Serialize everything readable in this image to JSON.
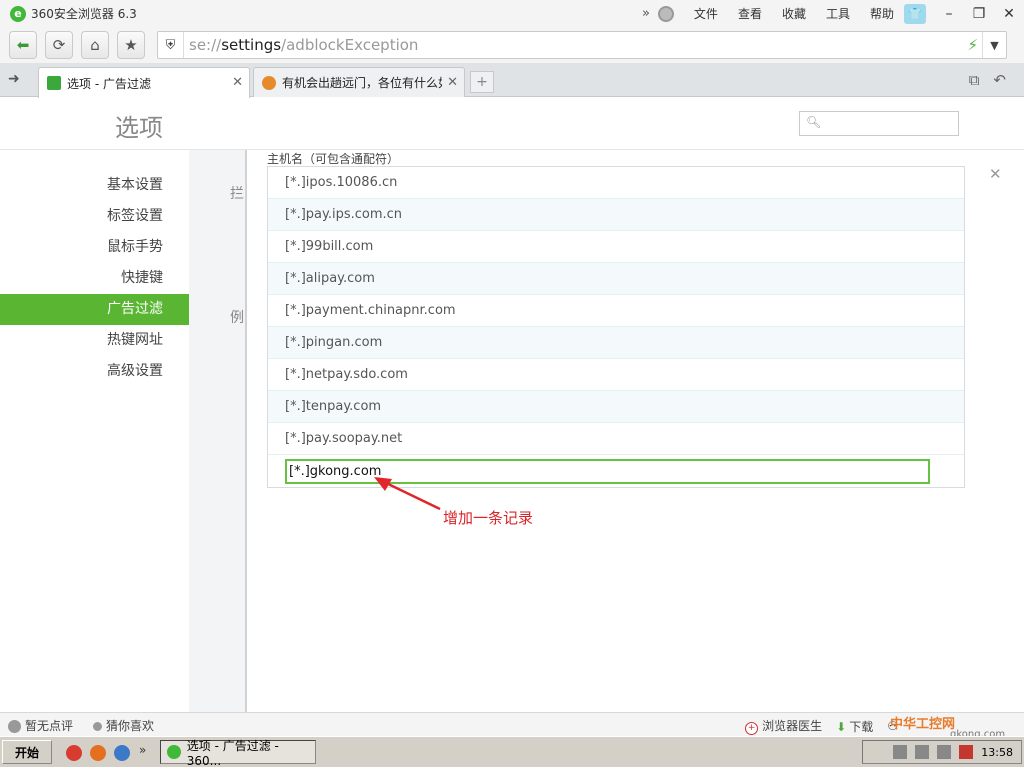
{
  "window": {
    "app_title": "360安全浏览器 6.3",
    "menus": [
      "文件",
      "查看",
      "收藏",
      "工具",
      "帮助"
    ]
  },
  "navbar": {
    "url_scheme": "se://",
    "url_path": "settings",
    "url_rest": "/adblockException"
  },
  "tabs": [
    {
      "label": "选项 - 广告过滤",
      "active": true
    },
    {
      "label": "有机会出趟远门，各位有什么如",
      "active": false
    }
  ],
  "settings": {
    "title": "选项",
    "search_placeholder": ""
  },
  "sidebar": {
    "items": [
      {
        "label": "基本设置"
      },
      {
        "label": "标签设置"
      },
      {
        "label": "鼠标手势"
      },
      {
        "label": "快捷键"
      },
      {
        "label": "广告过滤",
        "active": true
      },
      {
        "label": "热键网址"
      },
      {
        "label": "高级设置"
      }
    ]
  },
  "behind_panel": {
    "label_a": "拦",
    "label_b": "例"
  },
  "host_list": {
    "header": "主机名（可包含通配符）",
    "rows": [
      "[*.]ipos.10086.cn",
      "[*.]pay.ips.com.cn",
      "[*.]99bill.com",
      "[*.]alipay.com",
      "[*.]payment.chinapnr.com",
      "[*.]pingan.com",
      "[*.]netpay.sdo.com",
      "[*.]tenpay.com",
      "[*.]pay.soopay.net"
    ],
    "input_value": "[*.]gkong.com"
  },
  "annotation": {
    "text": "增加一条记录",
    "color": "#d9242a"
  },
  "statusbar": {
    "left_a": "暂无点评",
    "left_b": "猜你喜欢",
    "doctor": "浏览器医生",
    "download": "下载",
    "watermark": "中华工控网",
    "watermark_url": "gkong.com"
  },
  "taskbar": {
    "start": "开始",
    "task": "选项 - 广告过滤 - 360...",
    "clock": "13:58"
  },
  "colors": {
    "accent_green": "#5ab632",
    "input_border": "#66c23f"
  }
}
